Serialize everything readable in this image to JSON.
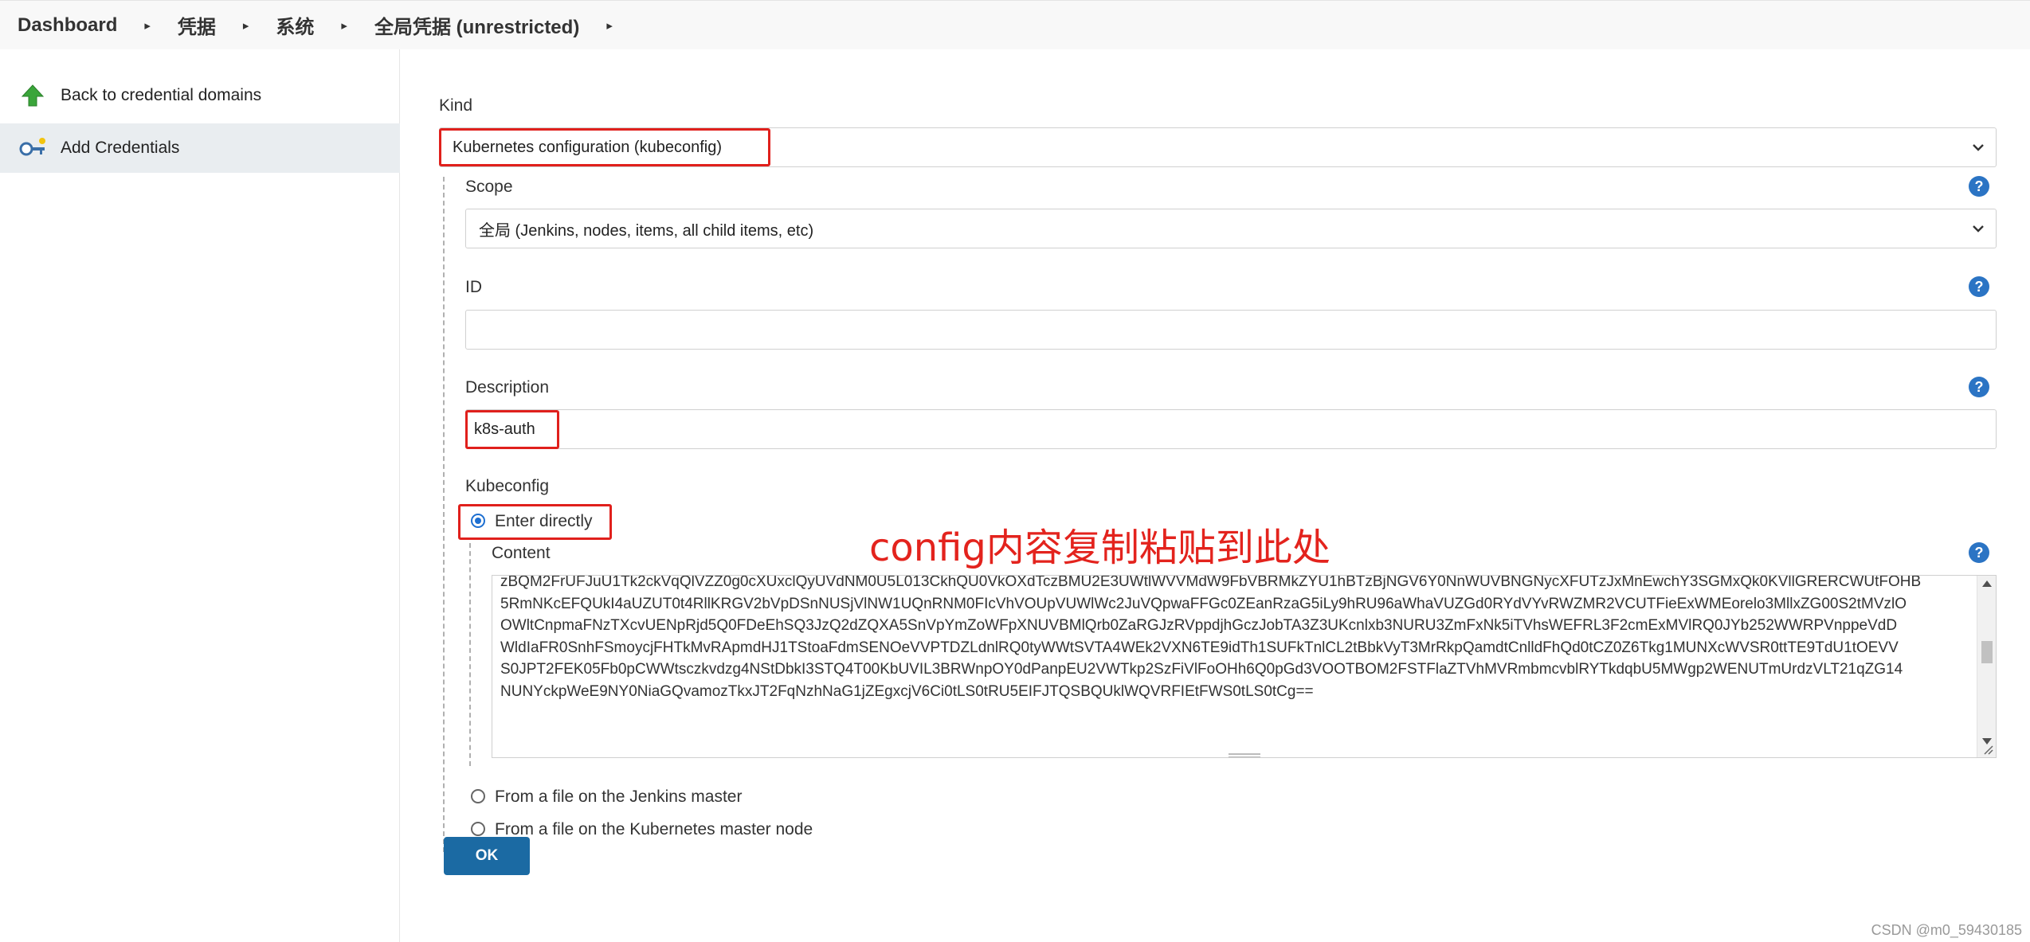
{
  "breadcrumb": {
    "items": [
      "Dashboard",
      "凭据",
      "系统",
      "全局凭据 (unrestricted)"
    ]
  },
  "sidebar": {
    "back_label": "Back to credential domains",
    "add_label": "Add Credentials"
  },
  "form": {
    "kind_label": "Kind",
    "kind_value": "Kubernetes configuration (kubeconfig)",
    "scope_label": "Scope",
    "scope_value": "全局 (Jenkins, nodes, items, all child items, etc)",
    "id_label": "ID",
    "id_value": "",
    "description_label": "Description",
    "description_value": "k8s-auth",
    "kubeconfig_label": "Kubeconfig",
    "option_enter_directly": "Enter directly",
    "content_label": "Content",
    "content_lines": [
      "zBQM2FrUFJuU1Tk2ckVqQlVZZ0g0cXUxclQyUVdNM0U5L013CkhQU0VkOXdTczBMU2E3UWtlWVVMdW9FbVBRMkZYU1hBTzBjNGV6Y0NnWUVBNGNycXFUTzJxMnEwchY3SGMxQk0KVllGRERCWUtFOHB",
      "5RmNKcEFQUkI4aUZUT0t4RllKRGV2bVpDSnNUSjVlNW1UQnRNM0FIcVhVOUpVUWlWc2JuVQpwaFFGc0ZEanRzaG5iLy9hRU96aWhaVUZGd0RYdVYvRWZMR2VCUTFieExWMEorelo3MllxZG00S2tMVzlO",
      "OWltCnpmaFNzTXcvUENpRjd5Q0FDeEhSQ3JzQ2dZQXA5SnVpYmZoWFpXNUVBMlQrb0ZaRGJzRVppdjhGczJobTA3Z3UKcnlxb3NURU3ZmFxNk5iTVhsWEFRL3F2cmExMVlRQ0JYb252WWRPVnppeVdD",
      "WldIaFR0SnhFSmoycjFHTkMvRApmdHJ1TStoaFdmSENOeVVPTDZLdnlRQ0tyWWtSVTA4WEk2VXN6TE9idTh1SUFkTnlCL2tBbkVyT3MrRkpQamdtCnlldFhQd0tCZ0Z6Tkg1MUNXcWVSR0ttTE9TdU1tOEVV",
      "S0JPT2FEK05Fb0pCWWtsczkvdzg4NStDbkI3STQ4T00KbUVIL3BRWnpOY0dPanpEU2VWTkp2SzFiVlFoOHh6Q0pGd3VOOTBOM2FSTFlaZTVhMVRmbmcvblRYTkdqbU5MWgp2WENUTmUrdzVLT21qZG14",
      "NUNYckpWeE9NY0NiaGQvamozTkxJT2FqNzhNaG1jZEgxcjV6Ci0tLS0tRU5EIFJTQSBQUklWQVRFIEtFWS0tLS0tCg=="
    ],
    "option_from_master": "From a file on the Jenkins master",
    "option_from_k8s": "From a file on the Kubernetes master node",
    "ok_label": "OK"
  },
  "annotation": "config内容复制粘贴到此处",
  "watermark": "CSDN @m0_59430185",
  "colors": {
    "highlight": "#e0201c",
    "help_icon": "#2b74c4",
    "ok_button": "#1b6aa3",
    "annotation": "#e3231d"
  }
}
